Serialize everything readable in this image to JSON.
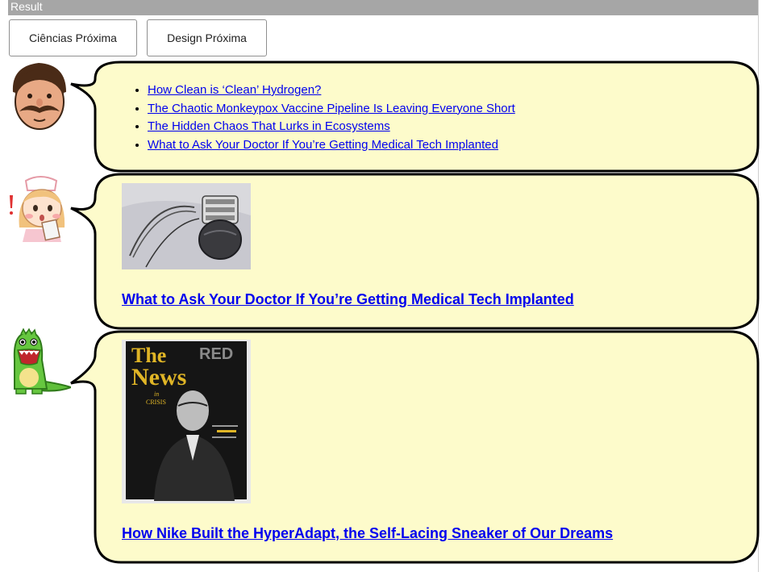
{
  "header": {
    "title": "Result"
  },
  "nav": {
    "ciencias_label": "Ciências Próxima",
    "design_label": "Design Próxima"
  },
  "colors": {
    "bubble_fill": "#fdfbcb",
    "link": "#0000ee",
    "bar": "#a6a6a6"
  },
  "list_bubble": {
    "avatar_icon": "man-mustache-avatar",
    "links": [
      "How Clean is ‘Clean’ Hydrogen?",
      "The Chaotic Monkeypox Vaccine Pipeline Is Leaving Everyone Short",
      "The Hidden Chaos That Lurks in Ecosystems",
      "What to Ask Your Doctor If You’re Getting Medical Tech Implanted"
    ]
  },
  "cards": [
    {
      "avatar_icon": "nurse-avatar",
      "image_icon": "pacemaker-device-image",
      "title": "What to Ask Your Doctor If You’re Getting Medical Tech Implanted"
    },
    {
      "avatar_icon": "green-dinosaur-avatar",
      "image_icon": "magazine-cover-image",
      "title": "How Nike Built the HyperAdapt, the Self-Lacing Sneaker of Our Dreams",
      "cover": {
        "masthead": "RED",
        "headline_1": "The",
        "headline_2": "News",
        "sub_1": "in",
        "sub_2": "CRISIS"
      }
    }
  ]
}
